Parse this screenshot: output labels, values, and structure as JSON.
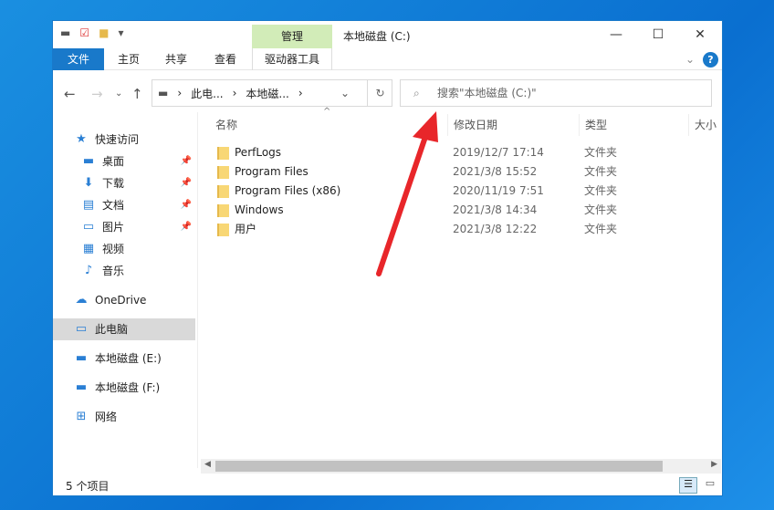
{
  "window": {
    "title": "本地磁盘 (C:)",
    "context_tab": "管理",
    "minimize": "—",
    "maximize": "☐",
    "close": "✕"
  },
  "ribbon": {
    "tabs": [
      "文件",
      "主页",
      "共享",
      "查看",
      "驱动器工具"
    ]
  },
  "address": {
    "crumbs": [
      "此电...",
      "本地磁..."
    ],
    "search_placeholder": "搜索\"本地磁盘 (C:)\""
  },
  "sidebar": [
    {
      "label": "快速访问",
      "icon": "★"
    },
    {
      "label": "桌面",
      "icon": "▬",
      "pin": true
    },
    {
      "label": "下载",
      "icon": "⬇",
      "pin": true
    },
    {
      "label": "文档",
      "icon": "▤",
      "pin": true
    },
    {
      "label": "图片",
      "icon": "▭",
      "pin": true
    },
    {
      "label": "视频",
      "icon": "▦"
    },
    {
      "label": "音乐",
      "icon": "♪"
    },
    {
      "label": "OneDrive",
      "icon": "☁"
    },
    {
      "label": "此电脑",
      "icon": "▭"
    },
    {
      "label": "本地磁盘 (E:)",
      "icon": "▬"
    },
    {
      "label": "本地磁盘 (F:)",
      "icon": "▬"
    },
    {
      "label": "网络",
      "icon": "⊞"
    }
  ],
  "columns": [
    "名称",
    "修改日期",
    "类型",
    "大小"
  ],
  "files": [
    {
      "name": "PerfLogs",
      "date": "2019/12/7 17:14",
      "type": "文件夹"
    },
    {
      "name": "Program Files",
      "date": "2021/3/8 15:52",
      "type": "文件夹"
    },
    {
      "name": "Program Files (x86)",
      "date": "2020/11/19 7:51",
      "type": "文件夹"
    },
    {
      "name": "Windows",
      "date": "2021/3/8 14:34",
      "type": "文件夹"
    },
    {
      "name": "用户",
      "date": "2021/3/8 12:22",
      "type": "文件夹"
    }
  ],
  "status": "5 个项目",
  "annotation_color": "#e8262a"
}
